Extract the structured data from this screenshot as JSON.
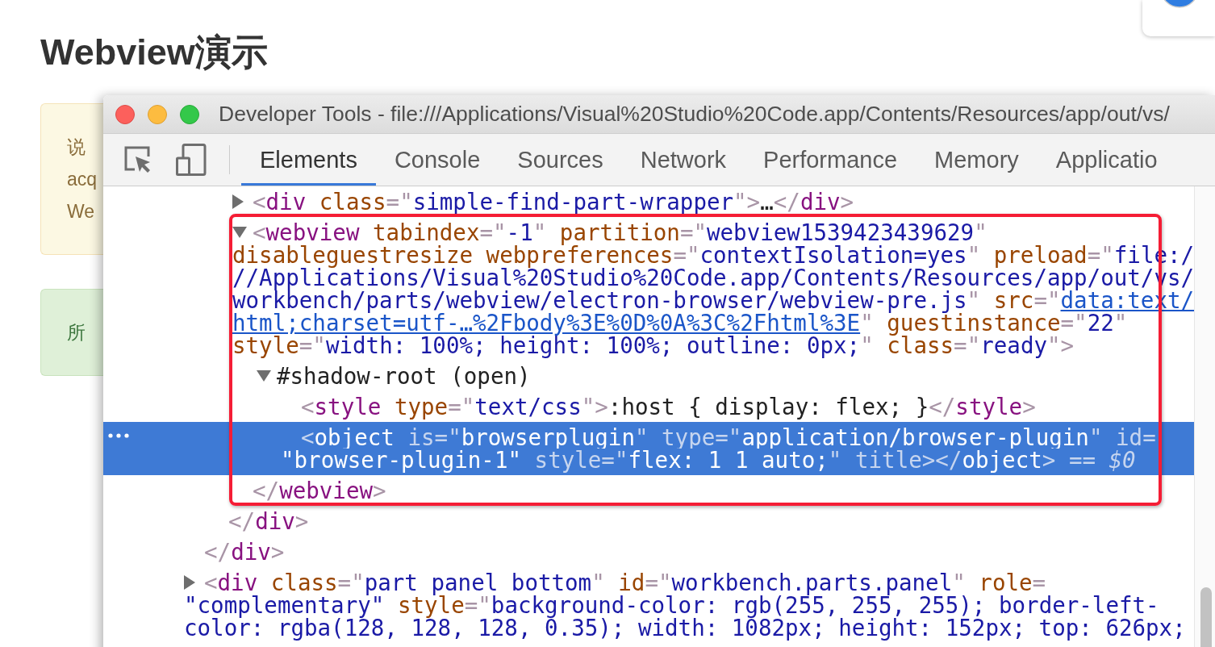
{
  "page": {
    "heading": "Webview演示",
    "callouts": [
      {
        "kind": "warning",
        "lines": [
          "说",
          "acq",
          "We"
        ]
      },
      {
        "kind": "success",
        "lines": [
          "所"
        ]
      }
    ]
  },
  "window": {
    "title": "Developer Tools - file:///Applications/Visual%20Studio%20Code.app/Contents/Resources/app/out/vs/"
  },
  "tabs": [
    {
      "label": "Elements",
      "selected": true
    },
    {
      "label": "Console",
      "selected": false
    },
    {
      "label": "Sources",
      "selected": false
    },
    {
      "label": "Network",
      "selected": false
    },
    {
      "label": "Performance",
      "selected": false
    },
    {
      "label": "Memory",
      "selected": false
    },
    {
      "label": "Applicatio",
      "selected": false
    }
  ],
  "dom_tree": [
    {
      "selected": false,
      "children": [
        {
          "selected": false,
          "children": [
            {
              "expanded": false,
              "selected": false,
              "lines": [
                [
                  {
                    "kind": "punct",
                    "text": "<"
                  },
                  {
                    "kind": "tag",
                    "text": "div"
                  },
                  {
                    "kind": "attr",
                    "text": " class"
                  },
                  {
                    "kind": "punct",
                    "text": "=\""
                  },
                  {
                    "kind": "value",
                    "text": "simple-find-part-wrapper"
                  },
                  {
                    "kind": "punct",
                    "text": "\">"
                  },
                  {
                    "kind": "text",
                    "text": "…"
                  },
                  {
                    "kind": "punct",
                    "text": "</"
                  },
                  {
                    "kind": "tag",
                    "text": "div"
                  },
                  {
                    "kind": "punct",
                    "text": ">"
                  }
                ]
              ]
            },
            {
              "expanded": true,
              "selected": false,
              "lines": [
                [
                  {
                    "kind": "punct",
                    "text": "<"
                  },
                  {
                    "kind": "tag",
                    "text": "webview"
                  },
                  {
                    "kind": "attr",
                    "text": " tabindex"
                  },
                  {
                    "kind": "punct",
                    "text": "=\""
                  },
                  {
                    "kind": "value",
                    "text": "-1"
                  },
                  {
                    "kind": "punct",
                    "text": "\""
                  },
                  {
                    "kind": "attr",
                    "text": " partition"
                  },
                  {
                    "kind": "punct",
                    "text": "=\""
                  },
                  {
                    "kind": "value",
                    "text": "webview1539423439629"
                  },
                  {
                    "kind": "punct",
                    "text": "\""
                  }
                ],
                [
                  {
                    "kind": "attr",
                    "text": "disableguestresize webpreferences"
                  },
                  {
                    "kind": "punct",
                    "text": "=\""
                  },
                  {
                    "kind": "value",
                    "text": "contextIsolation=yes"
                  },
                  {
                    "kind": "punct",
                    "text": "\""
                  },
                  {
                    "kind": "attr",
                    "text": " preload"
                  },
                  {
                    "kind": "punct",
                    "text": "=\""
                  },
                  {
                    "kind": "value",
                    "text": "file:/"
                  }
                ],
                [
                  {
                    "kind": "value",
                    "text": "//Applications/Visual%20Studio%20Code.app/Contents/Resources/app/out/vs/"
                  }
                ],
                [
                  {
                    "kind": "value",
                    "text": "workbench/parts/webview/electron-browser/webview-pre.js"
                  },
                  {
                    "kind": "punct",
                    "text": "\""
                  },
                  {
                    "kind": "attr",
                    "text": " src"
                  },
                  {
                    "kind": "punct",
                    "text": "=\""
                  },
                  {
                    "kind": "link",
                    "text": "data:text/"
                  }
                ],
                [
                  {
                    "kind": "link",
                    "text": "html;charset=utf-…%2Fbody%3E%0D%0A%3C%2Fhtml%3E"
                  },
                  {
                    "kind": "punct",
                    "text": "\""
                  },
                  {
                    "kind": "attr",
                    "text": " guestinstance"
                  },
                  {
                    "kind": "punct",
                    "text": "=\""
                  },
                  {
                    "kind": "value",
                    "text": "22"
                  },
                  {
                    "kind": "punct",
                    "text": "\""
                  }
                ],
                [
                  {
                    "kind": "attr",
                    "text": "style"
                  },
                  {
                    "kind": "punct",
                    "text": "=\""
                  },
                  {
                    "kind": "value",
                    "text": "width: 100%; height: 100%; outline: 0px;"
                  },
                  {
                    "kind": "punct",
                    "text": "\""
                  },
                  {
                    "kind": "attr",
                    "text": " class"
                  },
                  {
                    "kind": "punct",
                    "text": "=\""
                  },
                  {
                    "kind": "value",
                    "text": "ready"
                  },
                  {
                    "kind": "punct",
                    "text": "\">"
                  }
                ]
              ],
              "children": [
                {
                  "expanded": true,
                  "selected": false,
                  "lines": [
                    [
                      {
                        "kind": "text",
                        "text": "#shadow-root (open)"
                      }
                    ]
                  ],
                  "children": [
                    {
                      "selected": false,
                      "lines": [
                        [
                          {
                            "kind": "punct",
                            "text": "<"
                          },
                          {
                            "kind": "tag",
                            "text": "style"
                          },
                          {
                            "kind": "attr",
                            "text": " type"
                          },
                          {
                            "kind": "punct",
                            "text": "=\""
                          },
                          {
                            "kind": "value",
                            "text": "text/css"
                          },
                          {
                            "kind": "punct",
                            "text": "\">"
                          },
                          {
                            "kind": "text",
                            "text": ":host { display: flex; }"
                          },
                          {
                            "kind": "punct",
                            "text": "</"
                          },
                          {
                            "kind": "tag",
                            "text": "style"
                          },
                          {
                            "kind": "punct",
                            "text": ">"
                          }
                        ]
                      ]
                    },
                    {
                      "selected": true,
                      "lines": [
                        [
                          {
                            "kind": "punct",
                            "text": "<"
                          },
                          {
                            "kind": "tag",
                            "text": "object"
                          },
                          {
                            "kind": "attr",
                            "text": " is"
                          },
                          {
                            "kind": "punct",
                            "text": "=\""
                          },
                          {
                            "kind": "value",
                            "text": "browserplugin"
                          },
                          {
                            "kind": "punct",
                            "text": "\""
                          },
                          {
                            "kind": "attr",
                            "text": " type"
                          },
                          {
                            "kind": "punct",
                            "text": "=\""
                          },
                          {
                            "kind": "value",
                            "text": "application/browser-plugin"
                          },
                          {
                            "kind": "punct",
                            "text": "\""
                          },
                          {
                            "kind": "attr",
                            "text": " id"
                          },
                          {
                            "kind": "punct",
                            "text": "="
                          }
                        ],
                        [
                          {
                            "kind": "value",
                            "text": "\"browser-plugin-1\""
                          },
                          {
                            "kind": "attr",
                            "text": " style"
                          },
                          {
                            "kind": "punct",
                            "text": "=\""
                          },
                          {
                            "kind": "value",
                            "text": "flex: 1 1 auto;"
                          },
                          {
                            "kind": "punct",
                            "text": "\""
                          },
                          {
                            "kind": "attr",
                            "text": " title"
                          },
                          {
                            "kind": "punct",
                            "text": "></"
                          },
                          {
                            "kind": "tag",
                            "text": "object"
                          },
                          {
                            "kind": "punct",
                            "text": ">"
                          },
                          {
                            "kind": "note",
                            "text": " == $0"
                          }
                        ]
                      ]
                    }
                  ]
                }
              ],
              "close": [
                {
                  "kind": "punct",
                  "text": "</"
                },
                {
                  "kind": "tag",
                  "text": "webview"
                },
                {
                  "kind": "punct",
                  "text": ">"
                }
              ]
            }
          ],
          "close": [
            {
              "kind": "punct",
              "text": "</"
            },
            {
              "kind": "tag",
              "text": "div"
            },
            {
              "kind": "punct",
              "text": ">"
            }
          ]
        }
      ],
      "close": [
        {
          "kind": "punct",
          "text": "</"
        },
        {
          "kind": "tag",
          "text": "div"
        },
        {
          "kind": "punct",
          "text": ">"
        }
      ]
    },
    {
      "expanded": false,
      "selected": false,
      "lines": [
        [
          {
            "kind": "punct",
            "text": "<"
          },
          {
            "kind": "tag",
            "text": "div"
          },
          {
            "kind": "attr",
            "text": " class"
          },
          {
            "kind": "punct",
            "text": "=\""
          },
          {
            "kind": "value",
            "text": "part panel bottom"
          },
          {
            "kind": "punct",
            "text": "\""
          },
          {
            "kind": "attr",
            "text": " id"
          },
          {
            "kind": "punct",
            "text": "=\""
          },
          {
            "kind": "value",
            "text": "workbench.parts.panel"
          },
          {
            "kind": "punct",
            "text": "\""
          },
          {
            "kind": "attr",
            "text": " role"
          },
          {
            "kind": "punct",
            "text": "="
          }
        ],
        [
          {
            "kind": "value",
            "text": "\"complementary\""
          },
          {
            "kind": "attr",
            "text": " style"
          },
          {
            "kind": "punct",
            "text": "=\""
          },
          {
            "kind": "value",
            "text": "background-color: rgb(255, 255, 255); border-left-"
          }
        ],
        [
          {
            "kind": "value",
            "text": "color: rgba(128, 128, 128, 0.35); width: 1082px; height: 152px; top: 626px;"
          }
        ]
      ]
    }
  ]
}
